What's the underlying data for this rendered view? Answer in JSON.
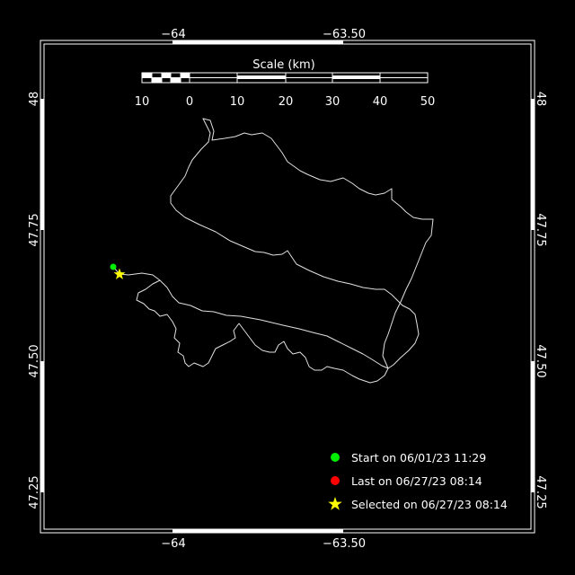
{
  "map": {
    "x_ticks": [
      "−64",
      "−63.50"
    ],
    "y_ticks": [
      "48",
      "47.75",
      "47.50",
      "47.25"
    ],
    "scale": {
      "title": "Scale (km)",
      "labels": [
        "10",
        "0",
        "10",
        "20",
        "30",
        "40",
        "50"
      ]
    },
    "legend": {
      "start": "Start on 06/01/23 11:29",
      "last": "Last on 06/27/23 08:14",
      "selected": "Selected on 06/27/23 08:14"
    },
    "colors": {
      "background": "#000000",
      "frame": "#ffffff",
      "track": "#e0e0e0",
      "start": "#00ee00",
      "last": "#ff0000",
      "selected": "#ffff00"
    }
  }
}
